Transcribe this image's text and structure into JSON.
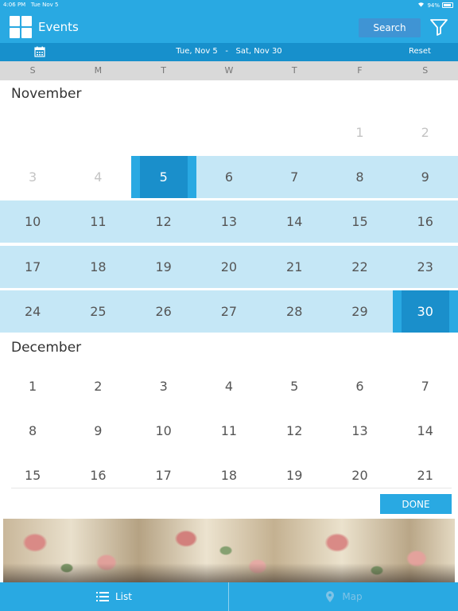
{
  "status_bar": {
    "time": "4:06 PM",
    "date": "Tue Nov 5",
    "battery": "94%"
  },
  "header": {
    "title": "Events",
    "search_label": "Search"
  },
  "range": {
    "start": "Tue, Nov 5",
    "separator": "-",
    "end": "Sat, Nov 30",
    "reset_label": "Reset"
  },
  "weekdays": [
    "S",
    "M",
    "T",
    "W",
    "T",
    "F",
    "S"
  ],
  "months": [
    {
      "name": "November",
      "weeks": [
        [
          "",
          "",
          "",
          "",
          "",
          "1",
          "2"
        ],
        [
          "3",
          "4",
          "5",
          "6",
          "7",
          "8",
          "9"
        ],
        [
          "10",
          "11",
          "12",
          "13",
          "14",
          "15",
          "16"
        ],
        [
          "17",
          "18",
          "19",
          "20",
          "21",
          "22",
          "23"
        ],
        [
          "24",
          "25",
          "26",
          "27",
          "28",
          "29",
          "30"
        ]
      ]
    },
    {
      "name": "December",
      "weeks": [
        [
          "1",
          "2",
          "3",
          "4",
          "5",
          "6",
          "7"
        ],
        [
          "8",
          "9",
          "10",
          "11",
          "12",
          "13",
          "14"
        ],
        [
          "15",
          "16",
          "17",
          "18",
          "19",
          "20",
          "21"
        ]
      ]
    }
  ],
  "selection": {
    "start_day": "5",
    "end_day": "30"
  },
  "done_label": "DONE",
  "tabs": {
    "list_label": "List",
    "map_label": "Map"
  },
  "colors": {
    "primary": "#29a9e2",
    "dark": "#1a8fcb",
    "range": "#c5e7f6"
  }
}
